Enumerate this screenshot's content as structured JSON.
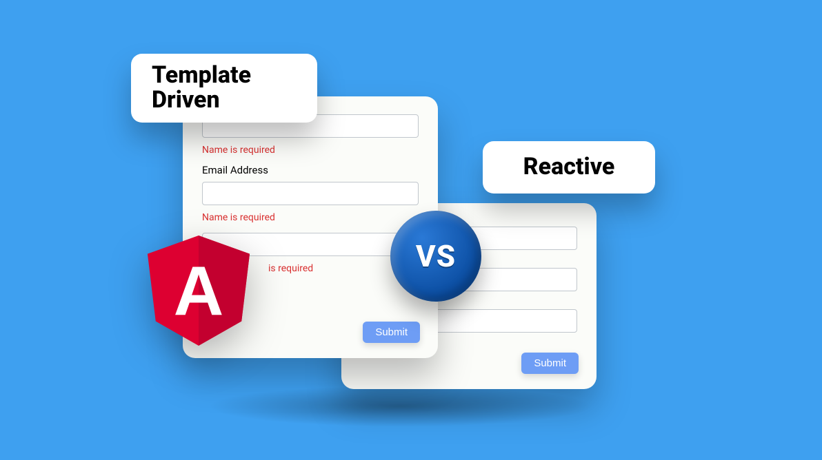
{
  "pills": {
    "template": "Template Driven",
    "reactive": "Reactive"
  },
  "vs": "VS",
  "angular_letter": "A",
  "left_form": {
    "error_name": "Name is required",
    "label_email": "Email Address",
    "error_email": "Name is required",
    "error_extra": "is required",
    "submit": "Submit"
  },
  "right_form": {
    "submit": "Submit"
  },
  "colors": {
    "background": "#3ea0f0",
    "error": "#d93030",
    "button": "#6e9df5",
    "vs_badge": "#0b4da1",
    "angular": "#dc2d3a"
  }
}
